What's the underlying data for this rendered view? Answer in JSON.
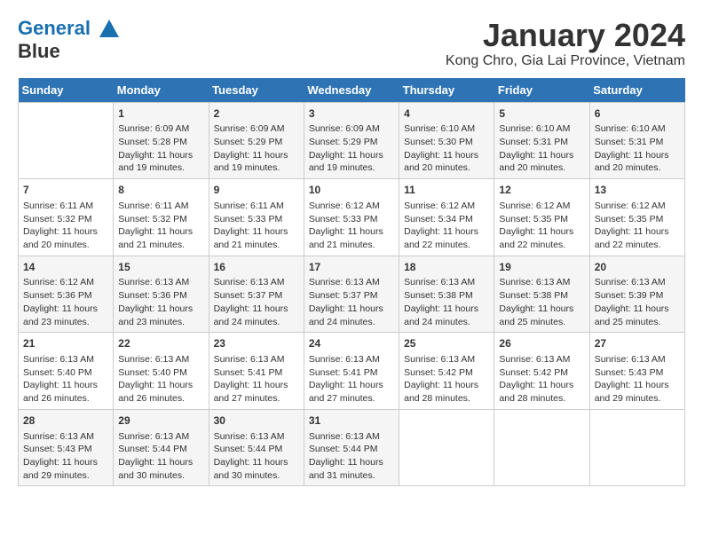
{
  "logo": {
    "line1": "General",
    "line2": "Blue"
  },
  "title": "January 2024",
  "subtitle": "Kong Chro, Gia Lai Province, Vietnam",
  "days_of_week": [
    "Sunday",
    "Monday",
    "Tuesday",
    "Wednesday",
    "Thursday",
    "Friday",
    "Saturday"
  ],
  "weeks": [
    [
      {
        "day": "",
        "content": ""
      },
      {
        "day": "1",
        "content": "Sunrise: 6:09 AM\nSunset: 5:28 PM\nDaylight: 11 hours\nand 19 minutes."
      },
      {
        "day": "2",
        "content": "Sunrise: 6:09 AM\nSunset: 5:29 PM\nDaylight: 11 hours\nand 19 minutes."
      },
      {
        "day": "3",
        "content": "Sunrise: 6:09 AM\nSunset: 5:29 PM\nDaylight: 11 hours\nand 19 minutes."
      },
      {
        "day": "4",
        "content": "Sunrise: 6:10 AM\nSunset: 5:30 PM\nDaylight: 11 hours\nand 20 minutes."
      },
      {
        "day": "5",
        "content": "Sunrise: 6:10 AM\nSunset: 5:31 PM\nDaylight: 11 hours\nand 20 minutes."
      },
      {
        "day": "6",
        "content": "Sunrise: 6:10 AM\nSunset: 5:31 PM\nDaylight: 11 hours\nand 20 minutes."
      }
    ],
    [
      {
        "day": "7",
        "content": "Sunrise: 6:11 AM\nSunset: 5:32 PM\nDaylight: 11 hours\nand 20 minutes."
      },
      {
        "day": "8",
        "content": "Sunrise: 6:11 AM\nSunset: 5:32 PM\nDaylight: 11 hours\nand 21 minutes."
      },
      {
        "day": "9",
        "content": "Sunrise: 6:11 AM\nSunset: 5:33 PM\nDaylight: 11 hours\nand 21 minutes."
      },
      {
        "day": "10",
        "content": "Sunrise: 6:12 AM\nSunset: 5:33 PM\nDaylight: 11 hours\nand 21 minutes."
      },
      {
        "day": "11",
        "content": "Sunrise: 6:12 AM\nSunset: 5:34 PM\nDaylight: 11 hours\nand 22 minutes."
      },
      {
        "day": "12",
        "content": "Sunrise: 6:12 AM\nSunset: 5:35 PM\nDaylight: 11 hours\nand 22 minutes."
      },
      {
        "day": "13",
        "content": "Sunrise: 6:12 AM\nSunset: 5:35 PM\nDaylight: 11 hours\nand 22 minutes."
      }
    ],
    [
      {
        "day": "14",
        "content": "Sunrise: 6:12 AM\nSunset: 5:36 PM\nDaylight: 11 hours\nand 23 minutes."
      },
      {
        "day": "15",
        "content": "Sunrise: 6:13 AM\nSunset: 5:36 PM\nDaylight: 11 hours\nand 23 minutes."
      },
      {
        "day": "16",
        "content": "Sunrise: 6:13 AM\nSunset: 5:37 PM\nDaylight: 11 hours\nand 24 minutes."
      },
      {
        "day": "17",
        "content": "Sunrise: 6:13 AM\nSunset: 5:37 PM\nDaylight: 11 hours\nand 24 minutes."
      },
      {
        "day": "18",
        "content": "Sunrise: 6:13 AM\nSunset: 5:38 PM\nDaylight: 11 hours\nand 24 minutes."
      },
      {
        "day": "19",
        "content": "Sunrise: 6:13 AM\nSunset: 5:38 PM\nDaylight: 11 hours\nand 25 minutes."
      },
      {
        "day": "20",
        "content": "Sunrise: 6:13 AM\nSunset: 5:39 PM\nDaylight: 11 hours\nand 25 minutes."
      }
    ],
    [
      {
        "day": "21",
        "content": "Sunrise: 6:13 AM\nSunset: 5:40 PM\nDaylight: 11 hours\nand 26 minutes."
      },
      {
        "day": "22",
        "content": "Sunrise: 6:13 AM\nSunset: 5:40 PM\nDaylight: 11 hours\nand 26 minutes."
      },
      {
        "day": "23",
        "content": "Sunrise: 6:13 AM\nSunset: 5:41 PM\nDaylight: 11 hours\nand 27 minutes."
      },
      {
        "day": "24",
        "content": "Sunrise: 6:13 AM\nSunset: 5:41 PM\nDaylight: 11 hours\nand 27 minutes."
      },
      {
        "day": "25",
        "content": "Sunrise: 6:13 AM\nSunset: 5:42 PM\nDaylight: 11 hours\nand 28 minutes."
      },
      {
        "day": "26",
        "content": "Sunrise: 6:13 AM\nSunset: 5:42 PM\nDaylight: 11 hours\nand 28 minutes."
      },
      {
        "day": "27",
        "content": "Sunrise: 6:13 AM\nSunset: 5:43 PM\nDaylight: 11 hours\nand 29 minutes."
      }
    ],
    [
      {
        "day": "28",
        "content": "Sunrise: 6:13 AM\nSunset: 5:43 PM\nDaylight: 11 hours\nand 29 minutes."
      },
      {
        "day": "29",
        "content": "Sunrise: 6:13 AM\nSunset: 5:44 PM\nDaylight: 11 hours\nand 30 minutes."
      },
      {
        "day": "30",
        "content": "Sunrise: 6:13 AM\nSunset: 5:44 PM\nDaylight: 11 hours\nand 30 minutes."
      },
      {
        "day": "31",
        "content": "Sunrise: 6:13 AM\nSunset: 5:44 PM\nDaylight: 11 hours\nand 31 minutes."
      },
      {
        "day": "",
        "content": ""
      },
      {
        "day": "",
        "content": ""
      },
      {
        "day": "",
        "content": ""
      }
    ]
  ]
}
